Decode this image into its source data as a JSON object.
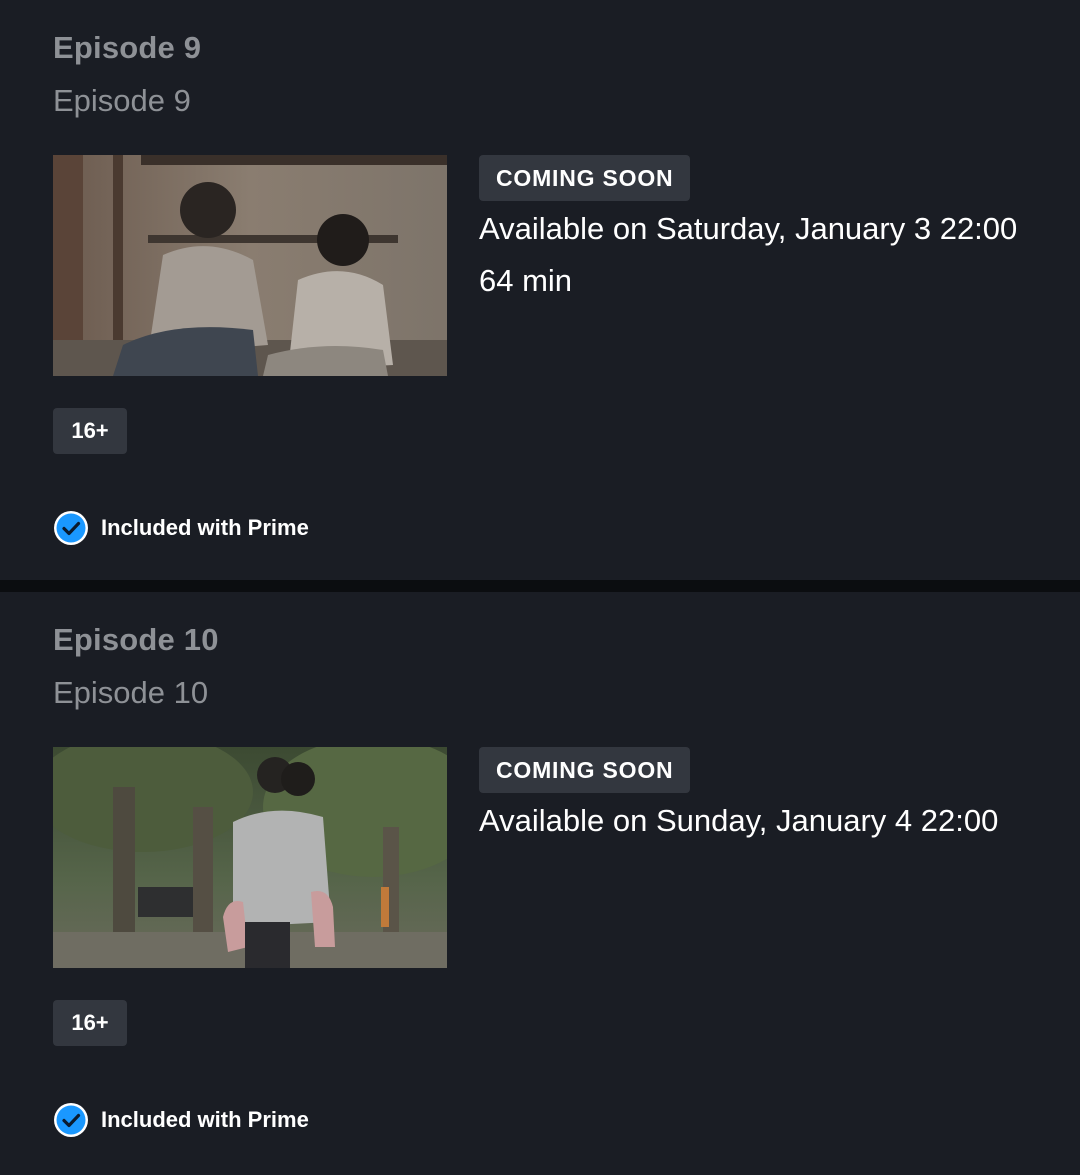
{
  "episodes": [
    {
      "title": "Episode 9",
      "subtitle": "Episode 9",
      "badge": "COMING SOON",
      "availability": "Available on Saturday, January 3 22:00",
      "duration": "64 min",
      "rating": "16+",
      "included": "Included with Prime"
    },
    {
      "title": "Episode 10",
      "subtitle": "Episode 10",
      "badge": "COMING SOON",
      "availability": "Available on Sunday, January 4 22:00",
      "rating": "16+",
      "included": "Included with Prime"
    }
  ],
  "colors": {
    "background": "#1a1d24",
    "separator": "#0b0d10",
    "badge_bg": "#33373f",
    "muted_text": "#8e9196",
    "check_blue": "#1a98ff"
  },
  "icons": {
    "included": "check-circle-icon"
  }
}
